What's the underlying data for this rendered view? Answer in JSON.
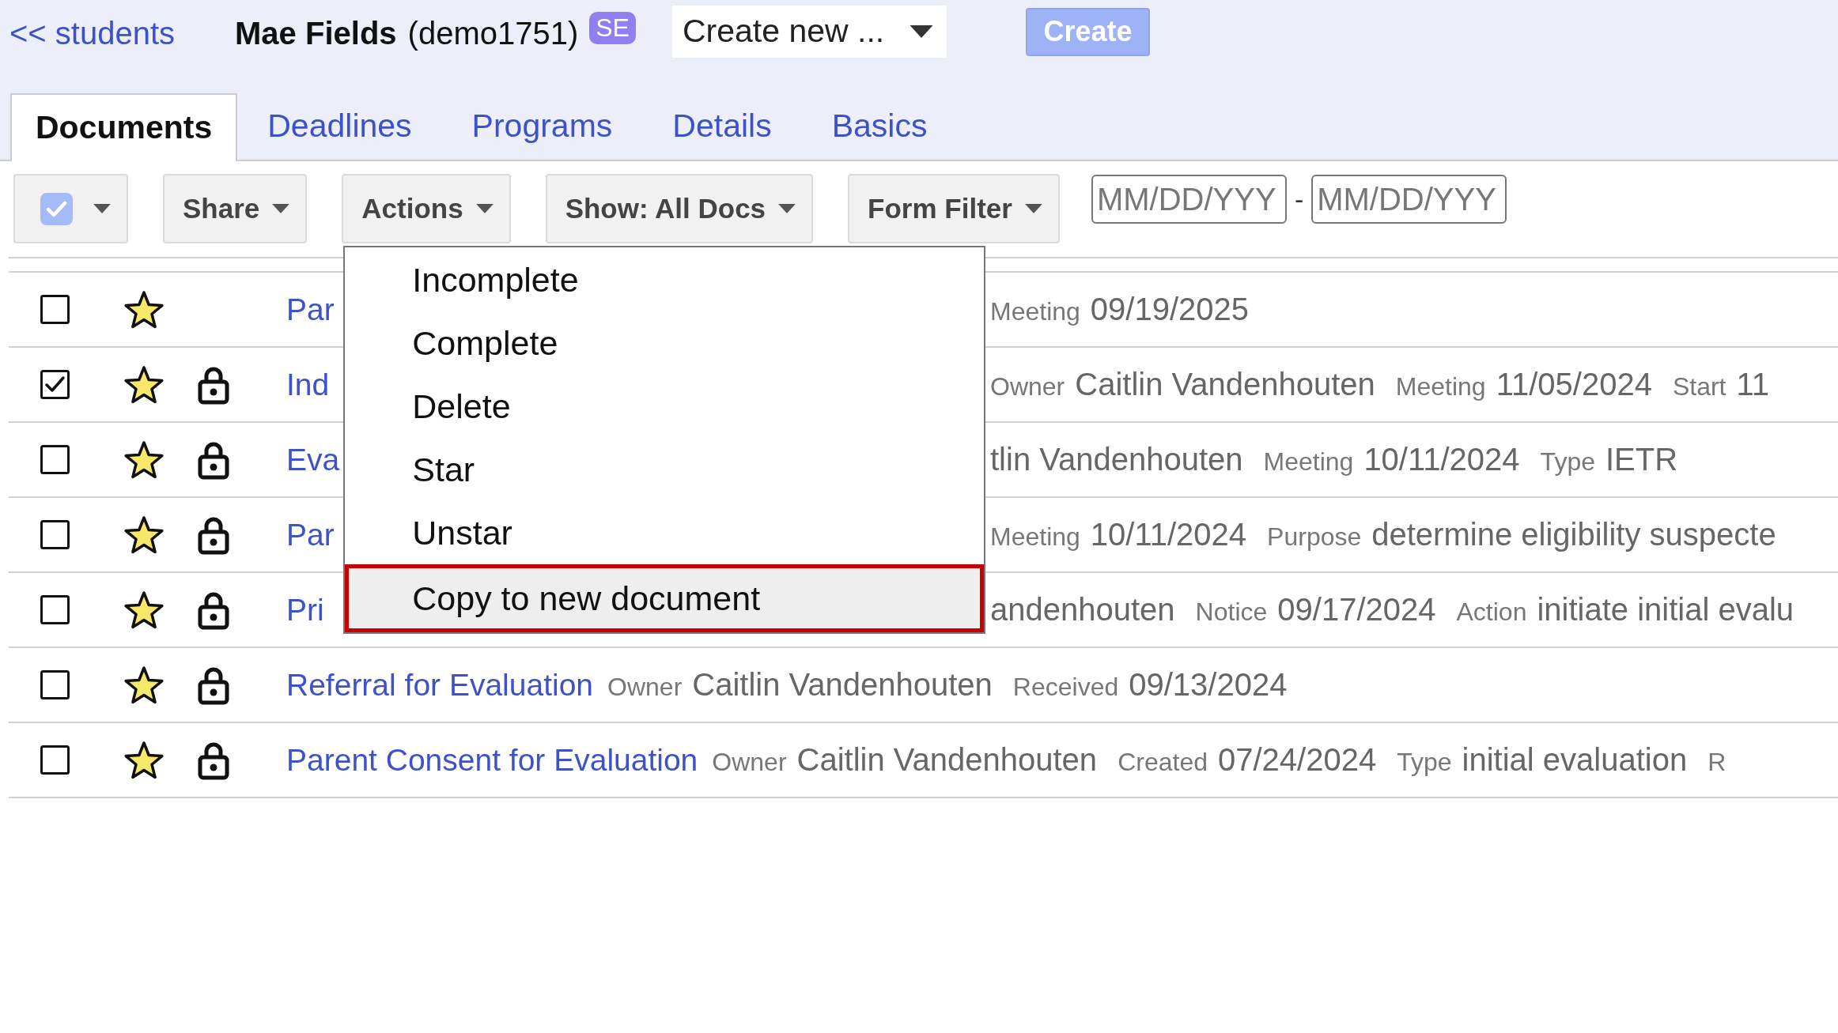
{
  "header": {
    "back_link": "<< students",
    "student_name": "Mae Fields",
    "student_id": "(demo1751)",
    "badge": "SE",
    "create_select": {
      "value": "Create new ..."
    },
    "create_button": {
      "label": "Create",
      "disabled": true
    }
  },
  "tabs": [
    {
      "label": "Documents",
      "selected": true
    },
    {
      "label": "Deadlines",
      "selected": false
    },
    {
      "label": "Programs",
      "selected": false
    },
    {
      "label": "Details",
      "selected": false
    },
    {
      "label": "Basics",
      "selected": false
    }
  ],
  "toolbar": {
    "select_all": {
      "checked": true
    },
    "buttons": [
      {
        "label": "Share"
      },
      {
        "label": "Actions",
        "menu": {
          "items": [
            {
              "label": "Incomplete",
              "selected": false
            },
            {
              "label": "Complete",
              "selected": false
            },
            {
              "label": "Delete",
              "selected": false
            },
            {
              "label": "Star",
              "selected": false
            },
            {
              "label": "Unstar",
              "selected": false
            },
            {
              "label": "Copy to new document",
              "selected": true
            }
          ]
        }
      },
      {
        "label": "Show: All Docs"
      },
      {
        "label": "Form Filter"
      }
    ],
    "date_from": {
      "placeholder": "MM/DD/YYY"
    },
    "date_separator": "-",
    "date_to": {
      "placeholder": "MM/DD/YYY"
    }
  },
  "documents": [
    {
      "checked": false,
      "starred": true,
      "locked": false,
      "title": "Par",
      "fields": [
        {
          "label": "Meeting",
          "value": "09/19/2025"
        }
      ]
    },
    {
      "checked": true,
      "starred": true,
      "locked": true,
      "title": "Ind",
      "fields": [
        {
          "label": "Owner",
          "value": "Caitlin Vandenhouten"
        },
        {
          "label": "Meeting",
          "value": "11/05/2024"
        },
        {
          "label": "Start",
          "value": "11"
        }
      ]
    },
    {
      "checked": false,
      "starred": true,
      "locked": true,
      "title": "Eva",
      "fields": [
        {
          "value": "tlin Vandenhouten"
        },
        {
          "label": "Meeting",
          "value": "10/11/2024"
        },
        {
          "label": "Type",
          "value": "IETR"
        }
      ]
    },
    {
      "checked": false,
      "starred": true,
      "locked": true,
      "title": "Par",
      "fields": [
        {
          "label": "Meeting",
          "value": "10/11/2024"
        },
        {
          "label": "Purpose",
          "value": "determine eligibility suspecte"
        }
      ]
    },
    {
      "checked": false,
      "starred": true,
      "locked": true,
      "title": "Pri",
      "fields": [
        {
          "value": "andenhouten"
        },
        {
          "label": "Notice",
          "value": "09/17/2024"
        },
        {
          "label": "Action",
          "value": "initiate initial evalu"
        }
      ]
    },
    {
      "checked": false,
      "starred": true,
      "locked": true,
      "title": "Referral for Evaluation",
      "fields": [
        {
          "label": "Owner",
          "value": "Caitlin Vandenhouten"
        },
        {
          "label": "Received",
          "value": "09/13/2024"
        }
      ]
    },
    {
      "checked": false,
      "starred": true,
      "locked": true,
      "title": "Parent Consent for Evaluation",
      "fields": [
        {
          "label": "Owner",
          "value": "Caitlin Vandenhouten"
        },
        {
          "label": "Created",
          "value": "07/24/2024"
        },
        {
          "label": "Type",
          "value": "initial evaluation"
        },
        {
          "label": "R"
        }
      ]
    }
  ]
}
